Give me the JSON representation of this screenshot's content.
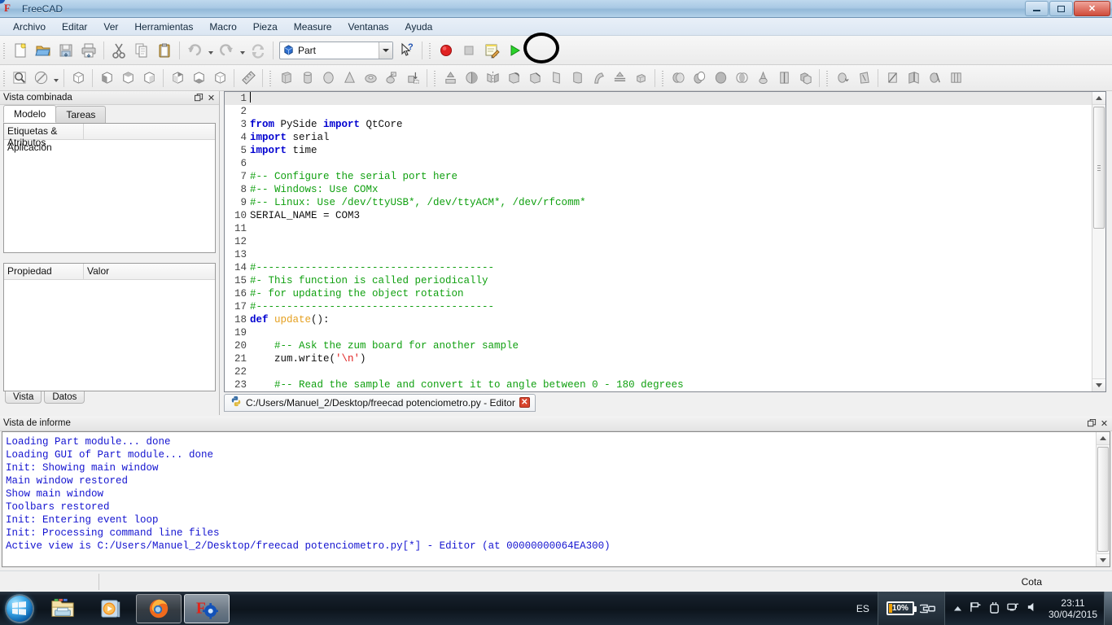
{
  "window": {
    "title": "FreeCAD",
    "app_icon": "freecad-logo-icon",
    "minimize_label": "Minimizar",
    "restore_label": "Restaurar",
    "close_label": "Cerrar"
  },
  "menubar": {
    "items": [
      {
        "label": "Archivo",
        "name": "menu-archivo"
      },
      {
        "label": "Editar",
        "name": "menu-editar"
      },
      {
        "label": "Ver",
        "name": "menu-ver"
      },
      {
        "label": "Herramientas",
        "name": "menu-herramientas"
      },
      {
        "label": "Macro",
        "name": "menu-macro"
      },
      {
        "label": "Pieza",
        "name": "menu-pieza"
      },
      {
        "label": "Measure",
        "name": "menu-measure"
      },
      {
        "label": "Ventanas",
        "name": "menu-ventanas"
      },
      {
        "label": "Ayuda",
        "name": "menu-ayuda"
      }
    ]
  },
  "toolbar_file": {
    "workbench_value": "Part",
    "buttons": [
      "new-document-icon",
      "open-document-icon",
      "save-document-icon",
      "print-document-icon",
      "cut-icon",
      "copy-icon",
      "paste-icon",
      "undo-icon",
      "redo-icon",
      "refresh-icon",
      "whats-this-icon",
      "macro-record-icon",
      "macro-stop-icon",
      "macro-edit-icon",
      "macro-execute-icon"
    ]
  },
  "toolbar_view": {
    "buttons": [
      "fit-all-icon",
      "draw-style-icon",
      "isometric-view-icon",
      "front-view-icon",
      "top-view-icon",
      "right-view-icon",
      "rear-view-icon",
      "bottom-view-icon",
      "left-view-icon",
      "measure-icon",
      "box-primitive-icon",
      "cylinder-primitive-icon",
      "sphere-primitive-icon",
      "cone-primitive-icon",
      "torus-primitive-icon",
      "create-primitives-icon",
      "shape-builder-icon",
      "extrude-icon",
      "revolve-icon",
      "mirror-icon",
      "fillet-icon",
      "chamfer-icon",
      "ruled-surface-icon",
      "loft-icon",
      "sweep-icon",
      "section-icon",
      "cross-sections-icon",
      "boolean-icon",
      "cut-boolean-icon",
      "union-icon",
      "intersection-icon",
      "join-connect-icon",
      "split-icon",
      "compound-icon",
      "check-geometry-icon",
      "defeaturing-icon",
      "boolean-fragments-icon",
      "slice-icon",
      "xor-icon",
      "split-apart-icon"
    ]
  },
  "combo_view": {
    "title": "Vista combinada",
    "float_icon": "float-panel-icon",
    "close_icon": "close-panel-icon",
    "tabs": [
      {
        "label": "Modelo",
        "active": true
      },
      {
        "label": "Tareas",
        "active": false
      }
    ],
    "tree": {
      "header_label": "Etiquetas & Atributos",
      "header_value_col": "",
      "rows": [
        "Aplicación"
      ]
    },
    "property_editor": {
      "columns": [
        "Propiedad",
        "Valor"
      ],
      "rows": [],
      "tabs": [
        {
          "label": "Vista",
          "active": true
        },
        {
          "label": "Datos",
          "active": false
        }
      ]
    }
  },
  "editor": {
    "tab_label": "C:/Users/Manuel_2/Desktop/freecad potenciometro.py - Editor",
    "tab_icon": "python-file-icon",
    "tab_close_icon": "close-tab-icon",
    "current_line": 1,
    "lines": [
      {
        "n": 1,
        "segments": [],
        "current": true
      },
      {
        "n": 2,
        "segments": []
      },
      {
        "n": 3,
        "segments": [
          {
            "t": "from ",
            "c": "k"
          },
          {
            "t": "PySide ",
            "c": ""
          },
          {
            "t": "import ",
            "c": "k"
          },
          {
            "t": "QtCore",
            "c": ""
          }
        ]
      },
      {
        "n": 4,
        "segments": [
          {
            "t": "import ",
            "c": "k"
          },
          {
            "t": "serial",
            "c": ""
          }
        ]
      },
      {
        "n": 5,
        "segments": [
          {
            "t": "import ",
            "c": "k"
          },
          {
            "t": "time",
            "c": ""
          }
        ]
      },
      {
        "n": 6,
        "segments": []
      },
      {
        "n": 7,
        "segments": [
          {
            "t": "#-- Configure the serial port here",
            "c": "c"
          }
        ]
      },
      {
        "n": 8,
        "segments": [
          {
            "t": "#-- Windows: Use COMx",
            "c": "c"
          }
        ]
      },
      {
        "n": 9,
        "segments": [
          {
            "t": "#-- Linux: Use /dev/ttyUSB*, /dev/ttyACM*, /dev/rfcomm*",
            "c": "c"
          }
        ]
      },
      {
        "n": 10,
        "segments": [
          {
            "t": "SERIAL_NAME = COM3",
            "c": ""
          }
        ]
      },
      {
        "n": 11,
        "segments": []
      },
      {
        "n": 12,
        "segments": []
      },
      {
        "n": 13,
        "segments": []
      },
      {
        "n": 14,
        "segments": [
          {
            "t": "#---------------------------------------",
            "c": "c"
          }
        ]
      },
      {
        "n": 15,
        "segments": [
          {
            "t": "#- This function is called periodically",
            "c": "c"
          }
        ]
      },
      {
        "n": 16,
        "segments": [
          {
            "t": "#- for updating the object rotation",
            "c": "c"
          }
        ]
      },
      {
        "n": 17,
        "segments": [
          {
            "t": "#---------------------------------------",
            "c": "c"
          }
        ]
      },
      {
        "n": 18,
        "segments": [
          {
            "t": "def ",
            "c": "k"
          },
          {
            "t": "update",
            "c": "fn"
          },
          {
            "t": "():",
            "c": ""
          }
        ]
      },
      {
        "n": 19,
        "segments": []
      },
      {
        "n": 20,
        "segments": [
          {
            "t": "    #-- Ask the zum board for another sample",
            "c": "c"
          }
        ]
      },
      {
        "n": 21,
        "segments": [
          {
            "t": "    zum.write(",
            "c": ""
          },
          {
            "t": "'\\n'",
            "c": "s"
          },
          {
            "t": ")",
            "c": ""
          }
        ]
      },
      {
        "n": 22,
        "segments": []
      },
      {
        "n": 23,
        "segments": [
          {
            "t": "    #-- Read the sample and convert it to angle between 0 - 180 degrees",
            "c": "c"
          }
        ]
      }
    ]
  },
  "report_view": {
    "title": "Vista de informe",
    "float_icon": "float-panel-icon",
    "close_icon": "close-panel-icon",
    "lines": [
      "Loading Part module... done",
      "Loading GUI of Part module... done",
      "Init: Showing main window",
      "Main window restored",
      "Show main window",
      "Toolbars restored",
      "Init: Entering event loop",
      "Init: Processing command line files",
      "Active view is C:/Users/Manuel_2/Desktop/freecad potenciometro.py[*] - Editor (at 00000000064EA300)"
    ],
    "text_color": "#1414d0"
  },
  "statusbar": {
    "dimension_label": "Cota"
  },
  "taskbar": {
    "start_label": "Inicio",
    "items": [
      {
        "name": "taskbar-file-explorer",
        "label": "Explorador de Windows",
        "state": "pinned"
      },
      {
        "name": "taskbar-media-player",
        "label": "Reproductor de Windows Media",
        "state": "pinned"
      },
      {
        "name": "taskbar-firefox",
        "label": "Mozilla Firefox",
        "state": "open"
      },
      {
        "name": "taskbar-freecad",
        "label": "FreeCAD",
        "state": "active"
      }
    ],
    "tray": {
      "language": "ES",
      "battery_percent": "10%",
      "icons": [
        "show-hidden-icons-chevron",
        "flag-action-center-icon",
        "power-plug-icon",
        "network-icon",
        "volume-icon"
      ],
      "time": "23:11",
      "date": "30/04/2015"
    }
  },
  "annotation": {
    "shape": "ellipse",
    "color": "#000000",
    "target": "macro-execute-button"
  }
}
